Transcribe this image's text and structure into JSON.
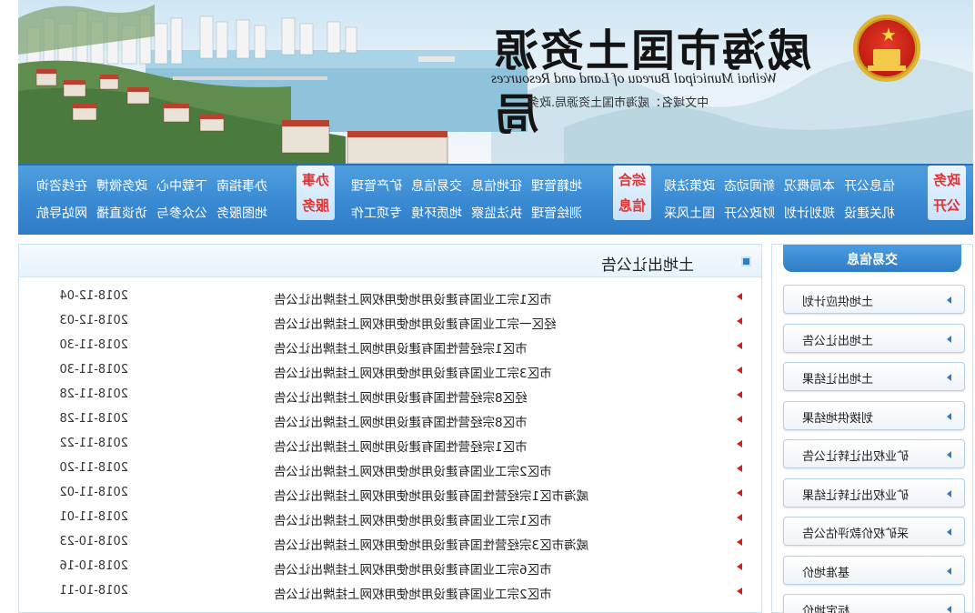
{
  "header": {
    "title_cn": "威海市国土资源局",
    "title_en": "Weihai Municipal Bureau of Land and Resources",
    "domain_label": "中文域名：威海市国土资源局.政务"
  },
  "nav": {
    "badge_gov": [
      "政务",
      "公开"
    ],
    "gov_row1": [
      "信息公开",
      "本局概况",
      "新闻动态",
      "政策法规"
    ],
    "gov_row2": [
      "机关建设",
      "规划计划",
      "财政公开",
      "国土风采"
    ],
    "badge_info": [
      "综合",
      "信息"
    ],
    "info_row1": [
      "地籍管理",
      "征地信息",
      "交易信息",
      "矿产管理"
    ],
    "info_row2": [
      "测绘管理",
      "执法监察",
      "地质环境",
      "专项工作"
    ],
    "badge_service": [
      "办事",
      "服务"
    ],
    "service_row1": [
      "办事指南",
      "下载中心",
      "政务微博",
      "在线咨询"
    ],
    "service_row2": [
      "地图服务",
      "公众参与",
      "访谈直播",
      "网站导航"
    ]
  },
  "main": {
    "section_title": "土地出让公告",
    "items": [
      {
        "title": "市区1宗工业国有建设用地使用权网上挂牌出让公告",
        "date": "2018-12-04"
      },
      {
        "title": "经区一宗工业国有建设用地使用权网上挂牌出让公告",
        "date": "2018-12-03"
      },
      {
        "title": "市区1宗经营性国有建设用地网上挂牌出让公告",
        "date": "2018-11-30"
      },
      {
        "title": "市区3宗工业国有建设用地使用权网上挂牌出让公告",
        "date": "2018-11-30"
      },
      {
        "title": "经区8宗经营性国有建设用地网上挂牌出让公告",
        "date": "2018-11-28"
      },
      {
        "title": "市区8宗经营性国有建设用地网上挂牌出让公告",
        "date": "2018-11-28"
      },
      {
        "title": "市区1宗经营性国有建设用地网上挂牌出让公告",
        "date": "2018-11-22"
      },
      {
        "title": "市区2宗工业国有建设用地使用权网上挂牌出让公告",
        "date": "2018-11-20"
      },
      {
        "title": "威海市区1宗经营性国有建设用地使用权网上挂牌出让公告",
        "date": "2018-11-02"
      },
      {
        "title": "市区1宗工业国有建设用地使用权网上挂牌出让公告",
        "date": "2018-11-01"
      },
      {
        "title": "威海市区3宗经营性国有建设用地使用权网上挂牌出让公告",
        "date": "2018-10-23"
      },
      {
        "title": "市区6宗工业国有建设用地使用权网上挂牌出让公告",
        "date": "2018-10-16"
      },
      {
        "title": "市区2宗工业国有建设用地使用权网上挂牌出让公告",
        "date": "2018-10-11"
      }
    ]
  },
  "sidebar": {
    "title": "交易信息",
    "items": [
      "土地供应计划",
      "土地出让公告",
      "土地出让结果",
      "划拨供地结果",
      "矿业权出让转让公告",
      "矿业权出让转让结果",
      "采矿权价款评估公告",
      "基准地价",
      "标定地价"
    ]
  },
  "colors": {
    "nav_blue": "#3a8bd3",
    "badge_red": "#e03434",
    "arrow_red": "#d11f1f"
  }
}
